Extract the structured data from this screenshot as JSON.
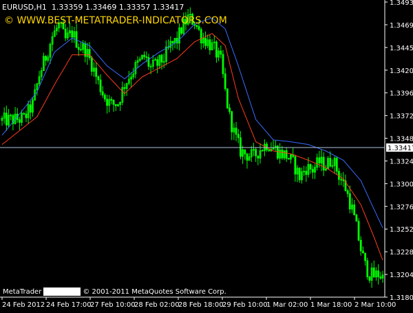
{
  "header": {
    "symbol": "EURUSD,H1",
    "ohlc": "1.33359 1.33469 1.33357 1.33417"
  },
  "watermark": "© WWW.BEST-METATRADER-INDICATORS.COM",
  "footer": {
    "app": "MetaTrader",
    "copyright": "© 2001-2011 MetaQuotes Software Corp."
  },
  "colors": {
    "background": "#000000",
    "candle": "#00ff00",
    "fast_ma": "#ff3b1f",
    "slow_ma": "#3a6cff",
    "price_line": "#b0c4de",
    "axis": "#ffffff",
    "current_price_bg": "#ffffff"
  },
  "chart_data": {
    "type": "candlestick",
    "ylim": [
      1.318,
      1.3499
    ],
    "yticks": [
      "1.34930",
      "1.34690",
      "1.34450",
      "1.34205",
      "1.33965",
      "1.33725",
      "1.33485",
      "1.33245",
      "1.33005",
      "1.32765",
      "1.32520",
      "1.32280",
      "1.32040",
      "1.31800"
    ],
    "xticks": [
      "24 Feb 2012",
      "24 Feb 17:00",
      "27 Feb 10:00",
      "28 Feb 02:00",
      "28 Feb 18:00",
      "29 Feb 10:00",
      "1 Mar 02:00",
      "1 Mar 18:00",
      "2 Mar 10:00"
    ],
    "current_price": 1.33417,
    "current_price_label": "1.33417",
    "close_path": [
      [
        0,
        1.3371
      ],
      [
        6,
        1.3372
      ],
      [
        10,
        1.3373
      ],
      [
        14,
        1.3388
      ],
      [
        17,
        1.342
      ],
      [
        20,
        1.344
      ],
      [
        23,
        1.3462
      ],
      [
        26,
        1.3474
      ],
      [
        29,
        1.3458
      ],
      [
        32,
        1.3466
      ],
      [
        35,
        1.3452
      ],
      [
        38,
        1.3448
      ],
      [
        41,
        1.3432
      ],
      [
        44,
        1.3412
      ],
      [
        47,
        1.3396
      ],
      [
        50,
        1.3388
      ],
      [
        53,
        1.339
      ],
      [
        56,
        1.341
      ],
      [
        59,
        1.3422
      ],
      [
        62,
        1.3432
      ],
      [
        65,
        1.344
      ],
      [
        68,
        1.3428
      ],
      [
        71,
        1.3432
      ],
      [
        74,
        1.3438
      ],
      [
        77,
        1.3452
      ],
      [
        80,
        1.3458
      ],
      [
        82,
        1.347
      ],
      [
        85,
        1.3482
      ],
      [
        88,
        1.3478
      ],
      [
        91,
        1.3462
      ],
      [
        94,
        1.3456
      ],
      [
        97,
        1.3448
      ],
      [
        100,
        1.3435
      ],
      [
        102,
        1.3402
      ],
      [
        104,
        1.3375
      ],
      [
        106,
        1.3358
      ],
      [
        109,
        1.3338
      ],
      [
        112,
        1.3334
      ],
      [
        115,
        1.3332
      ],
      [
        118,
        1.334
      ],
      [
        121,
        1.3346
      ],
      [
        124,
        1.3342
      ],
      [
        127,
        1.3336
      ],
      [
        130,
        1.3333
      ],
      [
        133,
        1.3325
      ],
      [
        136,
        1.331
      ],
      [
        139,
        1.332
      ],
      [
        142,
        1.3318
      ],
      [
        145,
        1.3326
      ],
      [
        148,
        1.3322
      ],
      [
        151,
        1.333
      ],
      [
        154,
        1.3312
      ],
      [
        157,
        1.3298
      ],
      [
        160,
        1.3275
      ],
      [
        162,
        1.3255
      ],
      [
        164,
        1.3232
      ],
      [
        166,
        1.3214
      ],
      [
        168,
        1.3205
      ],
      [
        170,
        1.3203
      ],
      [
        172,
        1.3205
      ],
      [
        174,
        1.3202
      ]
    ],
    "series": [
      {
        "path": [
          [
            0,
            1.3345
          ],
          [
            8,
            1.336
          ],
          [
            16,
            1.3375
          ],
          [
            24,
            1.341
          ],
          [
            32,
            1.3442
          ],
          [
            40,
            1.3442
          ],
          [
            48,
            1.342
          ],
          [
            56,
            1.34
          ],
          [
            64,
            1.3418
          ],
          [
            72,
            1.3428
          ],
          [
            80,
            1.3438
          ],
          [
            88,
            1.3456
          ],
          [
            96,
            1.3465
          ],
          [
            102,
            1.3452
          ],
          [
            108,
            1.3395
          ],
          [
            116,
            1.3348
          ],
          [
            124,
            1.3338
          ],
          [
            132,
            1.3335
          ],
          [
            140,
            1.3328
          ],
          [
            148,
            1.332
          ],
          [
            156,
            1.3308
          ],
          [
            164,
            1.328
          ],
          [
            170,
            1.3245
          ],
          [
            174,
            1.322
          ]
        ]
      },
      {
        "path": [
          [
            0,
            1.3355
          ],
          [
            8,
            1.3378
          ],
          [
            16,
            1.3402
          ],
          [
            24,
            1.3445
          ],
          [
            32,
            1.346
          ],
          [
            40,
            1.3452
          ],
          [
            48,
            1.343
          ],
          [
            56,
            1.3416
          ],
          [
            64,
            1.3432
          ],
          [
            72,
            1.3445
          ],
          [
            80,
            1.3456
          ],
          [
            88,
            1.3475
          ],
          [
            96,
            1.3482
          ],
          [
            102,
            1.347
          ],
          [
            108,
            1.343
          ],
          [
            116,
            1.3372
          ],
          [
            124,
            1.335
          ],
          [
            132,
            1.3348
          ],
          [
            140,
            1.3345
          ],
          [
            148,
            1.3338
          ],
          [
            156,
            1.3328
          ],
          [
            164,
            1.3306
          ],
          [
            170,
            1.3275
          ],
          [
            174,
            1.3255
          ]
        ]
      }
    ]
  }
}
